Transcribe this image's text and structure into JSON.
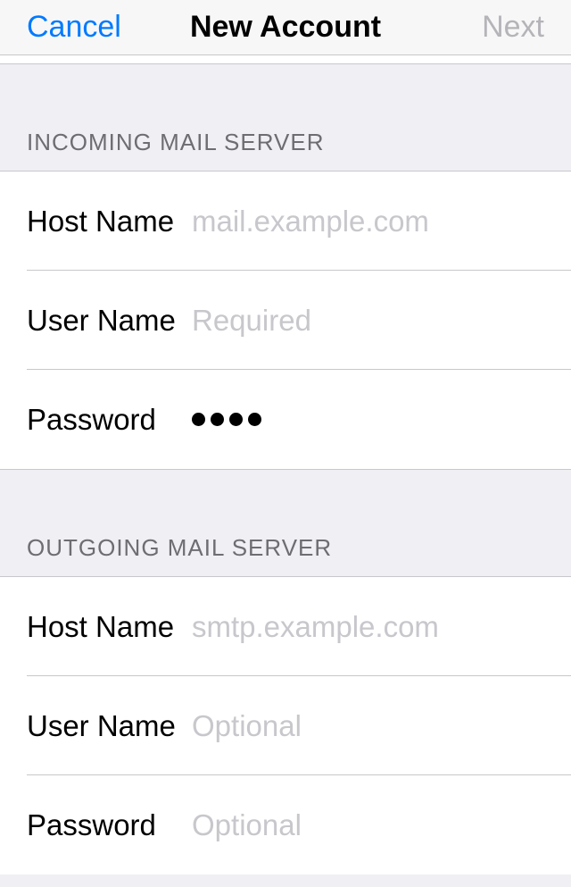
{
  "navbar": {
    "cancel": "Cancel",
    "title": "New Account",
    "next": "Next"
  },
  "incoming": {
    "header": "INCOMING MAIL SERVER",
    "host": {
      "label": "Host Name",
      "placeholder": "mail.example.com",
      "value": ""
    },
    "user": {
      "label": "User Name",
      "placeholder": "Required",
      "value": ""
    },
    "password": {
      "label": "Password",
      "dots": 4
    }
  },
  "outgoing": {
    "header": "OUTGOING MAIL SERVER",
    "host": {
      "label": "Host Name",
      "placeholder": "smtp.example.com",
      "value": ""
    },
    "user": {
      "label": "User Name",
      "placeholder": "Optional",
      "value": ""
    },
    "password": {
      "label": "Password",
      "placeholder": "Optional",
      "value": ""
    }
  }
}
